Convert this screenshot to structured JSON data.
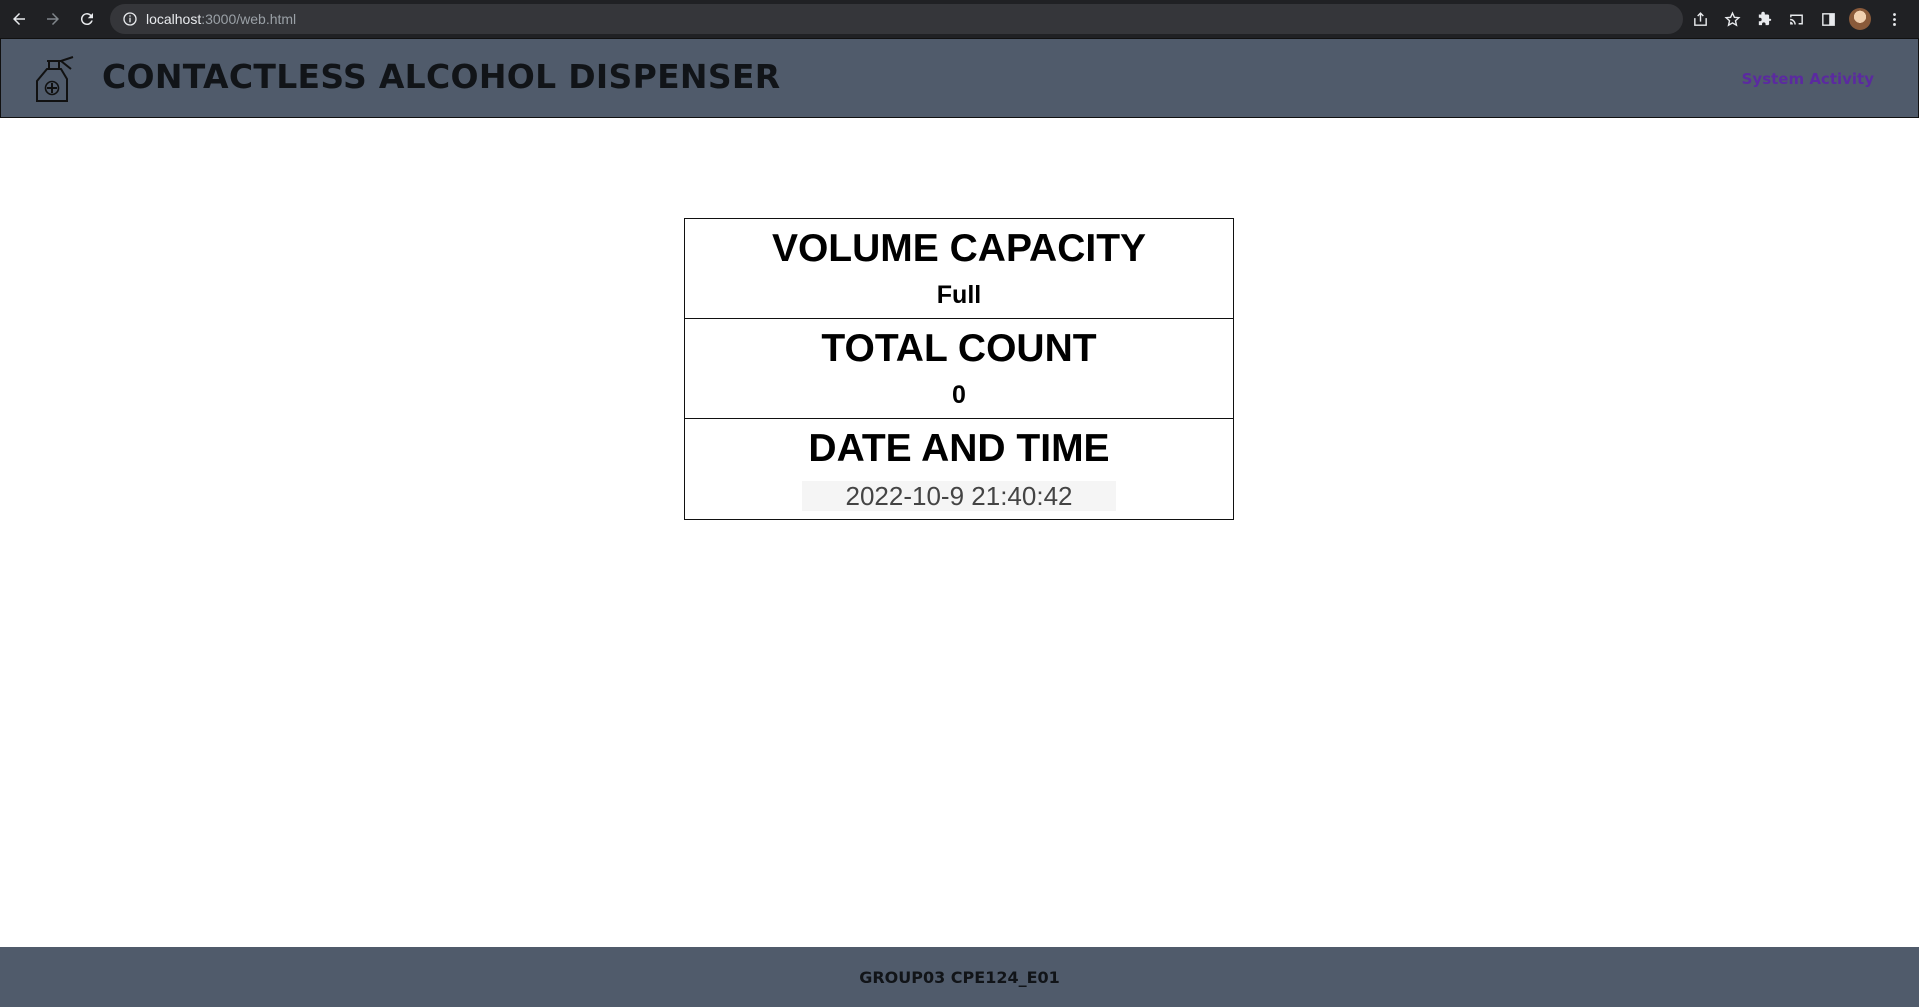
{
  "browser": {
    "url_host": "localhost",
    "url_path": ":3000/web.html"
  },
  "header": {
    "logo_icon": "sanitizer-spray-icon",
    "title": "CONTACTLESS ALCOHOL DISPENSER",
    "nav_link": "System Activity"
  },
  "status": {
    "volume": {
      "label": "VOLUME CAPACITY",
      "value": "Full"
    },
    "count": {
      "label": "TOTAL COUNT",
      "value": "0"
    },
    "datetime": {
      "label": "DATE AND TIME",
      "value": "2022-10-9 21:40:42"
    }
  },
  "footer": {
    "text": "GROUP03 CPE124_E01"
  },
  "colors": {
    "header_bg": "#505b6b",
    "footer_bg": "#505b6b",
    "link": "#5b2aa0"
  }
}
